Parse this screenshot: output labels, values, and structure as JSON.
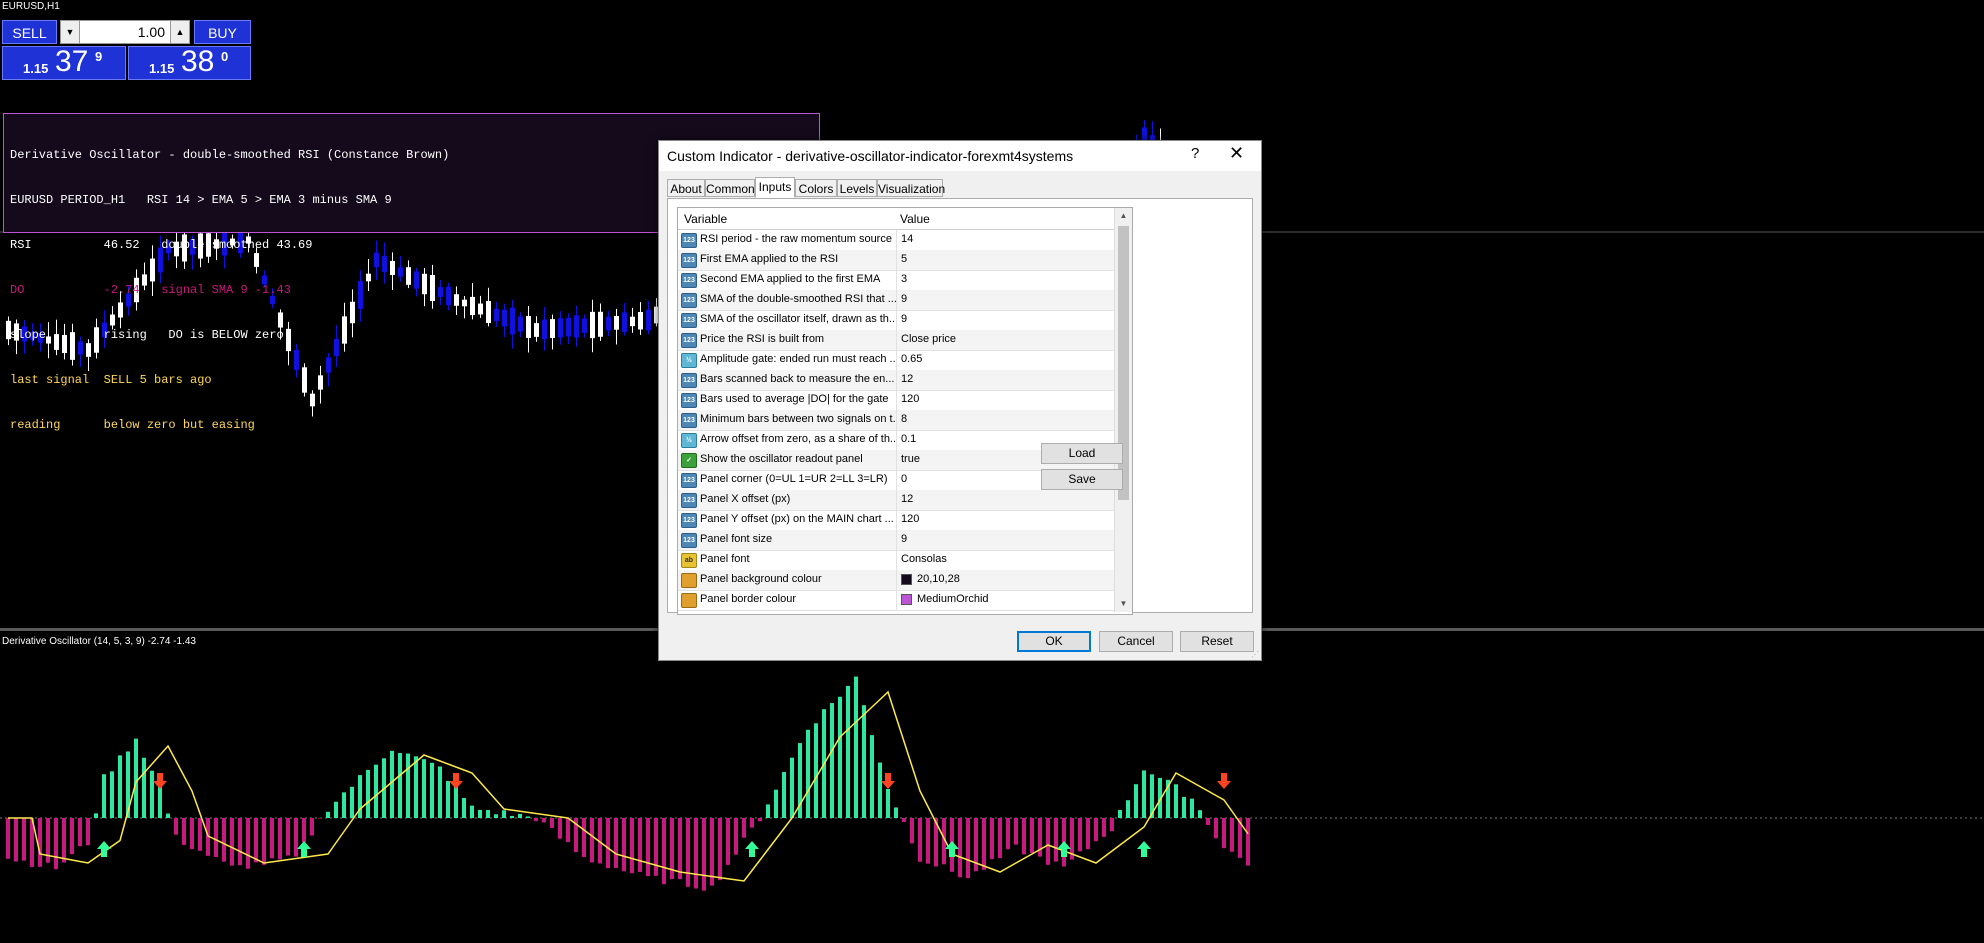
{
  "chart": {
    "symbol_title": "EURUSD,H1",
    "subwindow_title": "Derivative Oscillator (14, 5, 3, 9) -2.74 -1.43",
    "colors": {
      "bull": "#1010e0",
      "bear": "#ffffff",
      "hist_pos": "#2ee8a0",
      "hist_neg": "#c8197e",
      "signal": "#ffe94a",
      "arrow_up": "#33ff99",
      "arrow_down": "#ff4422"
    }
  },
  "trade": {
    "sell_label": "SELL",
    "buy_label": "BUY",
    "lot_value": "1.00",
    "lot_down_icon": "triangle-down",
    "lot_up_icon": "triangle-up",
    "bid": {
      "small": "1.15",
      "big": "37",
      "sup": "9"
    },
    "ask": {
      "small": "1.15",
      "big": "38",
      "sup": "0"
    }
  },
  "readout": {
    "lines": [
      {
        "text": "Derivative Oscillator - double-smoothed RSI (Constance Brown)",
        "color": "#ffffff"
      },
      {
        "text": "EURUSD PERIOD_H1   RSI 14 > EMA 5 > EMA 3 minus SMA 9",
        "color": "#ffffff"
      },
      {
        "text": "RSI          46.52   double-smoothed 43.69",
        "color": "#ffffff"
      },
      {
        "text": "DO           -2.74   signal SMA 9 -1.43",
        "color": "#c8197e"
      },
      {
        "text": "slope        rising   DO is BELOW zero",
        "color": "#ffffff"
      },
      {
        "text": "last signal  SELL 5 bars ago",
        "color": "#ffd75a"
      },
      {
        "text": "reading      below zero but easing",
        "color": "#ffd75a"
      }
    ]
  },
  "dialog": {
    "title": "Custom Indicator - derivative-oscillator-indicator-forexmt4systems",
    "help_label": "?",
    "close_label": "✕",
    "tabs": [
      "About",
      "Common",
      "Inputs",
      "Colors",
      "Levels",
      "Visualization"
    ],
    "active_tab": "Inputs",
    "columns": {
      "variable": "Variable",
      "value": "Value"
    },
    "rows": [
      {
        "icon": "int",
        "icon_text": "123",
        "variable": "RSI period - the raw momentum source",
        "value": "14"
      },
      {
        "icon": "int",
        "icon_text": "123",
        "variable": "First EMA applied to the RSI",
        "value": "5"
      },
      {
        "icon": "int",
        "icon_text": "123",
        "variable": "Second EMA applied to the first EMA",
        "value": "3"
      },
      {
        "icon": "int",
        "icon_text": "123",
        "variable": "SMA of the double-smoothed RSI that ...",
        "value": "9"
      },
      {
        "icon": "int",
        "icon_text": "123",
        "variable": "SMA of the oscillator itself, drawn as th...",
        "value": "9"
      },
      {
        "icon": "enum",
        "icon_text": "123",
        "variable": "Price the RSI is built from",
        "value": "Close price"
      },
      {
        "icon": "dbl",
        "icon_text": "½",
        "variable": "Amplitude gate: ended run must reach ...",
        "value": "0.65"
      },
      {
        "icon": "int",
        "icon_text": "123",
        "variable": "Bars scanned back to measure the en...",
        "value": "12"
      },
      {
        "icon": "int",
        "icon_text": "123",
        "variable": "Bars used to average |DO| for the gate",
        "value": "120"
      },
      {
        "icon": "int",
        "icon_text": "123",
        "variable": "Minimum bars between two signals on t...",
        "value": "8"
      },
      {
        "icon": "dbl",
        "icon_text": "½",
        "variable": "Arrow offset from zero, as a share of th...",
        "value": "0.1"
      },
      {
        "icon": "bool",
        "icon_text": "✓",
        "variable": "Show the oscillator readout panel",
        "value": "true"
      },
      {
        "icon": "int",
        "icon_text": "123",
        "variable": "Panel corner (0=UL 1=UR 2=LL 3=LR)",
        "value": "0"
      },
      {
        "icon": "int",
        "icon_text": "123",
        "variable": "Panel X offset (px)",
        "value": "12"
      },
      {
        "icon": "int",
        "icon_text": "123",
        "variable": "Panel Y offset (px) on the MAIN chart ...",
        "value": "120"
      },
      {
        "icon": "int",
        "icon_text": "123",
        "variable": "Panel font size",
        "value": "9"
      },
      {
        "icon": "str",
        "icon_text": "ab",
        "variable": "Panel font",
        "value": "Consolas"
      },
      {
        "icon": "clr",
        "icon_text": "",
        "variable": "Panel background colour",
        "value": "20,10,28",
        "swatch": "#140a1c"
      },
      {
        "icon": "clr",
        "icon_text": "",
        "variable": "Panel border colour",
        "value": "MediumOrchid",
        "swatch": "#ba55d3"
      }
    ],
    "buttons": {
      "load": "Load",
      "save": "Save",
      "ok": "OK",
      "cancel": "Cancel",
      "reset": "Reset"
    }
  }
}
